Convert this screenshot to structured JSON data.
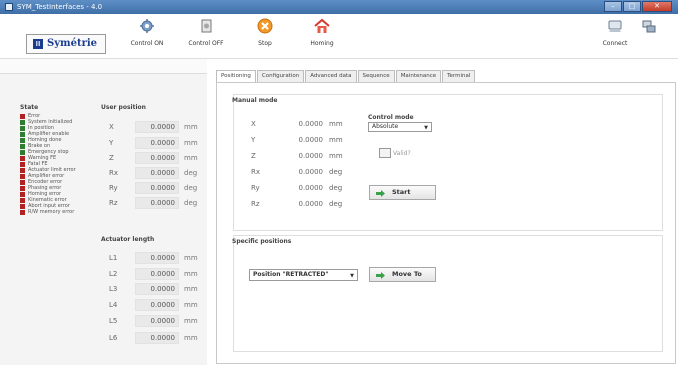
{
  "window": {
    "title": "SYM_TestInterfaces - 4.0",
    "controls": {
      "minimize": "–",
      "maximize": "□",
      "close": "✕"
    }
  },
  "toolbar": {
    "logo_text": "Symétrie",
    "buttons": [
      {
        "label": "Control ON",
        "icon": "gear-on-icon"
      },
      {
        "label": "Control OFF",
        "icon": "gear-off-icon"
      },
      {
        "label": "Stop",
        "icon": "stop-icon"
      },
      {
        "label": "Homing",
        "icon": "home-icon"
      },
      {
        "label": "Connect",
        "icon": "connect-icon"
      },
      {
        "label": "",
        "icon": "network-icon"
      }
    ]
  },
  "state": {
    "title": "State",
    "items": [
      {
        "label": "Error",
        "color": "#b22222"
      },
      {
        "label": "System initialized",
        "color": "#2e7d32"
      },
      {
        "label": "In position",
        "color": "#2e7d32"
      },
      {
        "label": "Amplifier enable",
        "color": "#2e7d32"
      },
      {
        "label": "Homing done",
        "color": "#2e7d32"
      },
      {
        "label": "Brake on",
        "color": "#2e7d32"
      },
      {
        "label": "Emergency stop",
        "color": "#2e7d32"
      },
      {
        "label": "Warning FE",
        "color": "#b22222"
      },
      {
        "label": "Fatal FE",
        "color": "#b22222"
      },
      {
        "label": "Actuator limit error",
        "color": "#b22222"
      },
      {
        "label": "Amplifier error",
        "color": "#b22222"
      },
      {
        "label": "Encoder error",
        "color": "#b22222"
      },
      {
        "label": "Phasing error",
        "color": "#b22222"
      },
      {
        "label": "Homing error",
        "color": "#b22222"
      },
      {
        "label": "Kinematic error",
        "color": "#b22222"
      },
      {
        "label": "Abort input error",
        "color": "#b22222"
      },
      {
        "label": "R/W memory error",
        "color": "#b22222"
      }
    ]
  },
  "user_position": {
    "title": "User position",
    "rows": [
      {
        "axis": "X",
        "value": "0.0000",
        "unit": "mm"
      },
      {
        "axis": "Y",
        "value": "0.0000",
        "unit": "mm"
      },
      {
        "axis": "Z",
        "value": "0.0000",
        "unit": "mm"
      },
      {
        "axis": "Rx",
        "value": "0.0000",
        "unit": "deg"
      },
      {
        "axis": "Ry",
        "value": "0.0000",
        "unit": "deg"
      },
      {
        "axis": "Rz",
        "value": "0.0000",
        "unit": "deg"
      }
    ]
  },
  "actuator_length": {
    "title": "Actuator length",
    "rows": [
      {
        "axis": "L1",
        "value": "0.0000",
        "unit": "mm"
      },
      {
        "axis": "L2",
        "value": "0.0000",
        "unit": "mm"
      },
      {
        "axis": "L3",
        "value": "0.0000",
        "unit": "mm"
      },
      {
        "axis": "L4",
        "value": "0.0000",
        "unit": "mm"
      },
      {
        "axis": "L5",
        "value": "0.0000",
        "unit": "mm"
      },
      {
        "axis": "L6",
        "value": "0.0000",
        "unit": "mm"
      }
    ]
  },
  "tabs": [
    "Positioning",
    "Configuration",
    "Advanced data",
    "Sequence",
    "Maintenance",
    "Terminal"
  ],
  "manual_mode": {
    "title": "Manual mode",
    "rows": [
      {
        "axis": "X",
        "value": "0.0000",
        "unit": "mm"
      },
      {
        "axis": "Y",
        "value": "0.0000",
        "unit": "mm"
      },
      {
        "axis": "Z",
        "value": "0.0000",
        "unit": "mm"
      },
      {
        "axis": "Rx",
        "value": "0.0000",
        "unit": "deg"
      },
      {
        "axis": "Ry",
        "value": "0.0000",
        "unit": "deg"
      },
      {
        "axis": "Rz",
        "value": "0.0000",
        "unit": "deg"
      }
    ],
    "control_mode_label": "Control mode",
    "control_mode_value": "Absolute",
    "checkbox_label": "Valid?",
    "start_label": "Start"
  },
  "specific_positions": {
    "title": "Specific positions",
    "select_value": "Position \"RETRACTED\"",
    "move_label": "Move To"
  }
}
